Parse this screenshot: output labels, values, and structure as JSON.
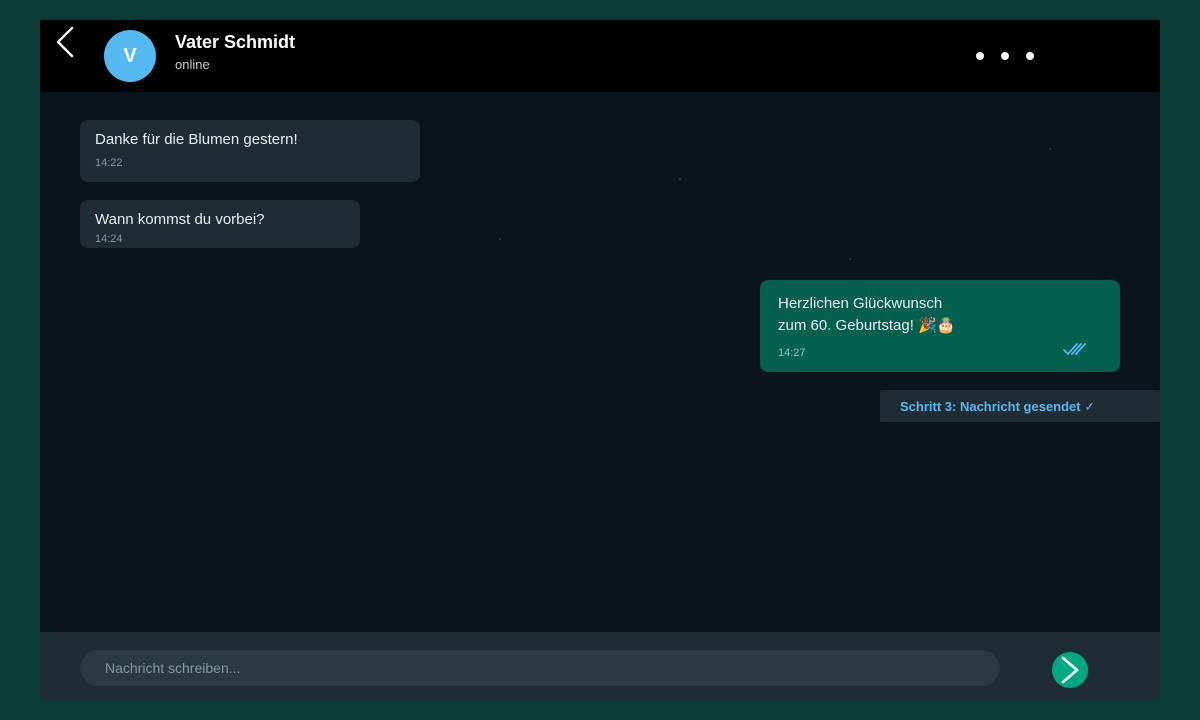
{
  "header": {
    "back_icon": "chevron-left-icon",
    "avatar_initial": "V",
    "contact_name": "Vater Schmidt",
    "status": "online",
    "menu_icon": "more-horizontal-icon"
  },
  "messages": [
    {
      "direction": "incoming",
      "text": "Danke für die Blumen gestern!",
      "time": "14:22"
    },
    {
      "direction": "incoming",
      "text": "Wann kommst du vorbei?",
      "time": "14:24"
    },
    {
      "direction": "outgoing",
      "text_lines": [
        "Herzlichen Glückwunsch",
        "zum 60. Geburtstag! 🎉🎂"
      ],
      "time": "14:27",
      "status_icon": "double-check-icon"
    }
  ],
  "step_badge": "Schritt 3: Nachricht gesendet ✓",
  "composer": {
    "placeholder": "Nachricht schreiben...",
    "send_icon": "send-arrow-icon"
  },
  "colors": {
    "page_background": "#0a3b34",
    "header": "#000000",
    "chat_background": "#0c141b",
    "incoming_bubble": "#1f2c34",
    "outgoing_bubble": "#035f4e",
    "accent_blue": "#55b8f0",
    "send_button": "#00a884"
  }
}
